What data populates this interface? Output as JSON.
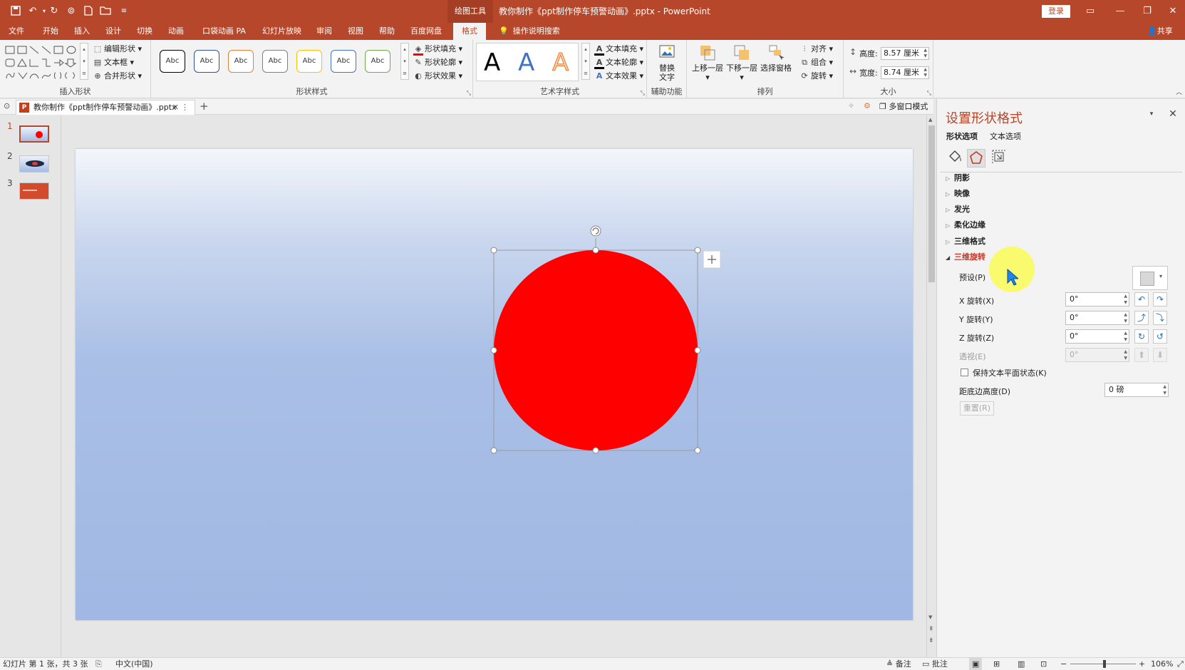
{
  "titlebar": {
    "context_tab": "绘图工具",
    "doc_title": "教你制作《ppt制作停车预警动画》.pptx  -  PowerPoint",
    "login": "登录"
  },
  "tabs": [
    {
      "label": "文件"
    },
    {
      "label": "开始"
    },
    {
      "label": "插入"
    },
    {
      "label": "设计"
    },
    {
      "label": "切换"
    },
    {
      "label": "动画"
    },
    {
      "label": "口袋动画 PA"
    },
    {
      "label": "幻灯片放映"
    },
    {
      "label": "审阅"
    },
    {
      "label": "视图"
    },
    {
      "label": "帮助"
    },
    {
      "label": "百度网盘"
    },
    {
      "label": "格式"
    }
  ],
  "tell_me": "操作说明搜索",
  "share": "共享",
  "ribbon": {
    "insert_shapes": {
      "label": "插入形状",
      "edit_shape": "编辑形状",
      "text_box": "文本框",
      "merge_shapes": "合并形状"
    },
    "shape_styles": {
      "label": "形状样式",
      "thumb_text": "Abc",
      "thumb_colors": [
        "#000000",
        "#2e5597",
        "#ed7d31",
        "#7f7f7f",
        "#ffc000",
        "#4472c4",
        "#70ad47"
      ],
      "fill": "形状填充",
      "outline": "形状轮廓",
      "effect": "形状效果"
    },
    "wordart": {
      "label": "艺术字样式",
      "letter": "A",
      "text_fill": "文本填充",
      "text_outline": "文本轮廓",
      "text_effect": "文本效果"
    },
    "accessibility": {
      "label": "辅助功能",
      "alt_text_line1": "替换",
      "alt_text_line2": "文字"
    },
    "arrange": {
      "label": "排列",
      "bring_forward": "上移一层",
      "send_backward": "下移一层",
      "selection_pane": "选择窗格",
      "align": "对齐",
      "group": "组合",
      "rotate": "旋转"
    },
    "size": {
      "label": "大小",
      "height_label": "高度:",
      "height_value": "8.57 厘米",
      "width_label": "宽度:",
      "width_value": "8.74 厘米"
    }
  },
  "doc_tab": {
    "name": "教你制作《ppt制作停车预警动画》.pptx",
    "multi_window": "多窗口模式"
  },
  "slides": [
    {
      "num": "1"
    },
    {
      "num": "2"
    },
    {
      "num": "3"
    }
  ],
  "shape": {
    "fill_color": "#ff0000"
  },
  "pane": {
    "title": "设置形状格式",
    "subtab_shape": "形状选项",
    "subtab_text": "文本选项",
    "sections": [
      {
        "label": "阴影"
      },
      {
        "label": "映像"
      },
      {
        "label": "发光"
      },
      {
        "label": "柔化边缘"
      },
      {
        "label": "三维格式"
      },
      {
        "label": "三维旋转"
      }
    ],
    "preset_label": "预设(P)",
    "x_rotation_label": "X 旋转(X)",
    "x_rotation_value": "0°",
    "y_rotation_label": "Y 旋转(Y)",
    "y_rotation_value": "0°",
    "z_rotation_label": "Z 旋转(Z)",
    "z_rotation_value": "0°",
    "perspective_label": "透视(E)",
    "perspective_value": "0°",
    "keep_text_flat": "保持文本平面状态(K)",
    "distance_label": "距底边高度(D)",
    "distance_value": "0 磅",
    "reset": "重置(R)"
  },
  "status": {
    "slide_info": "幻灯片 第 1 张，共 3 张",
    "language": "中文(中国)",
    "notes": "备注",
    "comments": "批注",
    "zoom": "106%"
  }
}
